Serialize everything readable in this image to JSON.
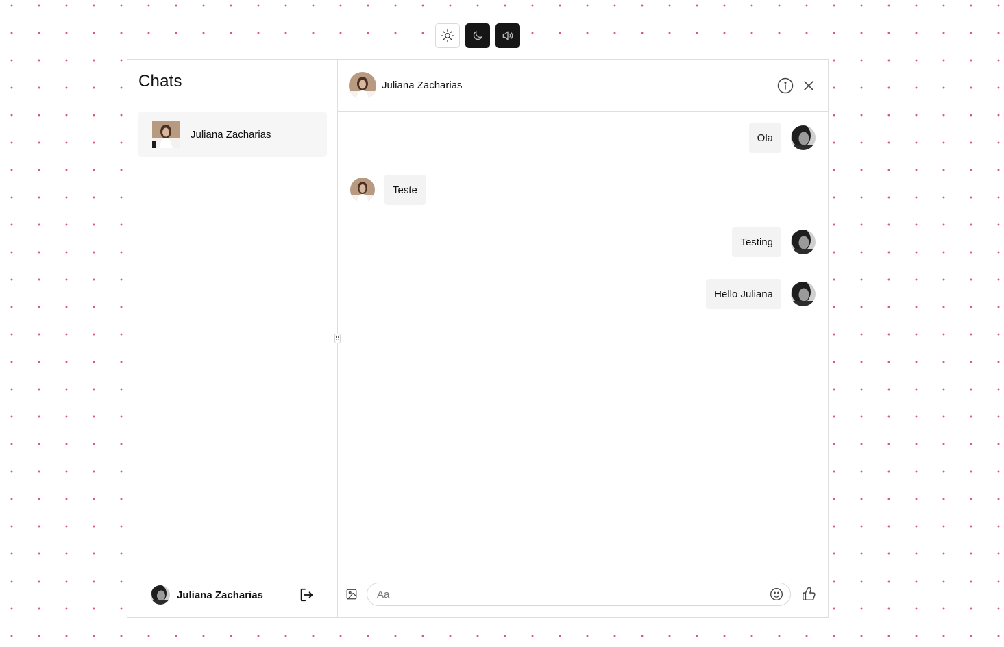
{
  "toolbar": {
    "buttons": [
      {
        "icon": "sun-icon",
        "variant": "light"
      },
      {
        "icon": "moon-icon",
        "variant": "dark"
      },
      {
        "icon": "volume-icon",
        "variant": "dark"
      }
    ]
  },
  "sidebar": {
    "title": "Chats",
    "chats": [
      {
        "name": "Juliana Zacharias",
        "avatar": "juliana-avatar"
      }
    ],
    "current_user": {
      "name": "Juliana Zacharias",
      "avatar": "user-avatar"
    }
  },
  "chat": {
    "contact_name": "Juliana Zacharias",
    "messages": [
      {
        "direction": "out",
        "text": "Ola"
      },
      {
        "direction": "in",
        "text": "Teste"
      },
      {
        "direction": "out",
        "text": "Testing"
      },
      {
        "direction": "out",
        "text": "Hello Juliana"
      }
    ],
    "composer": {
      "placeholder": "Aa"
    }
  },
  "colors": {
    "dot_pattern": "#e05a6e",
    "dark_button": "#161616",
    "bubble": "#f3f3f3",
    "border": "#dedede"
  }
}
